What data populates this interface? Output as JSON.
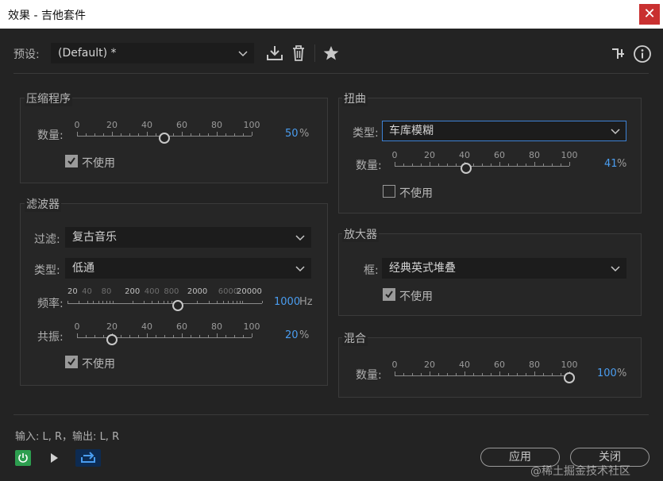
{
  "window": {
    "title": "效果 - 吉他套件",
    "close_glyph": "✕"
  },
  "toolbar": {
    "preset_label": "预设:",
    "preset_value": "(Default) *"
  },
  "compressor": {
    "title": "压缩程序",
    "amount_label": "数量:",
    "ticks": [
      "0",
      "20",
      "40",
      "60",
      "80",
      "100"
    ],
    "value": 50,
    "value_text": "50",
    "unit": "%",
    "bypass_label": "不使用",
    "bypass": true
  },
  "filter": {
    "title": "滤波器",
    "filter_label": "过滤:",
    "filter_value": "复古音乐",
    "type_label": "类型:",
    "type_value": "低通",
    "freq_label": "频率:",
    "freq_ticks": [
      "20",
      "40",
      "80",
      "200",
      "400",
      "800",
      "2000",
      "6000",
      "20000"
    ],
    "freq_value_text": "1000",
    "freq_unit": "Hz",
    "res_label": "共振:",
    "res_ticks": [
      "0",
      "20",
      "40",
      "60",
      "80",
      "100"
    ],
    "res_value": 20,
    "res_value_text": "20",
    "res_unit": "%",
    "bypass_label": "不使用",
    "bypass": true
  },
  "distortion": {
    "title": "扭曲",
    "type_label": "类型:",
    "type_value": "车库模糊",
    "amount_label": "数量:",
    "ticks": [
      "0",
      "20",
      "40",
      "60",
      "80",
      "100"
    ],
    "value": 41,
    "value_text": "41",
    "unit": "%",
    "bypass_label": "不使用",
    "bypass": false
  },
  "amplifier": {
    "title": "放大器",
    "box_label": "框:",
    "box_value": "经典英式堆叠",
    "bypass_label": "不使用",
    "bypass": true
  },
  "mix": {
    "title": "混合",
    "amount_label": "数量:",
    "ticks": [
      "0",
      "20",
      "40",
      "60",
      "80",
      "100"
    ],
    "value": 100,
    "value_text": "100",
    "unit": "%"
  },
  "footer": {
    "io_text": "输入: L, R，输出: L, R",
    "apply_label": "应用",
    "close_label": "关闭",
    "watermark": "@稀土掘金技术社区"
  },
  "colors": {
    "accent": "#4a9df0",
    "power": "#2d9e4f",
    "focus_border": "#3d82d6"
  },
  "icons": [
    "download-icon",
    "trash-icon",
    "star-icon",
    "routing-icon",
    "info-icon",
    "power-icon",
    "play-icon",
    "loop-icon",
    "chevron-down-icon",
    "checkmark-icon"
  ]
}
